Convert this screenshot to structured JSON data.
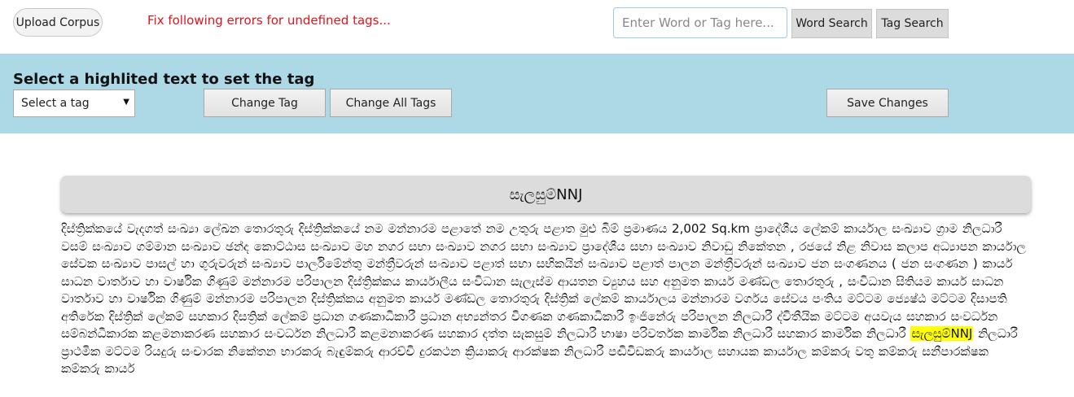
{
  "toolbar": {
    "upload_label": "Upload Corpus",
    "error_message": "Fix following errors for undefined tags...",
    "search_placeholder": "Enter Word or Tag here...",
    "word_search_label": "Word Search",
    "tag_search_label": "Tag Search"
  },
  "tag_bar": {
    "title": "Select a highlited text to set the tag",
    "select_value": "Select a tag",
    "change_tag_label": "Change Tag",
    "change_all_label": "Change All Tags",
    "save_label": "Save Changes",
    "background_color": "#add8e6"
  },
  "content": {
    "panel_heading": "සැලසුම්NNJ",
    "highlight_color": "#ffff00",
    "text_before": "දිස්ත්‍රික්කයේ වැදගත් සංඛ්‍යා ලේඛන තොරතුරු දිස්ත්‍රික්කයේ නම මන්නාරම පළාතේ නම උතුරු පළාත මුළු බිම් ප්‍රමාණය 2,002 Sq.km ප්‍රාදේශීය ලේකම් කාර්යාල සංඛ්‍යාව ග්‍රාම නිලධාරී වසම් සංඛ්‍යාව ගම්මාන සංඛ්‍යාව ඡන්ද කොට්ඨාස සංඛ්‍යාව මහ නගර සභා සංඛ්‍යාව නගර සභා සංඛ්‍යාව ප්‍රාදේශීය සභා සංඛ්‍යාව නිවාඩු නිකේතන , රජයේ නිළ නිවාස කලාප අධ්‍යාපන කාර්යාල සේවක සංඛ්‍යාව පාසල් හා ගුරුවරුන් සංඛ්‍යාව පාර්ලිමේන්තු මන්ත්‍රීවරුන් සංඛ්‍යාව පළාත් සභා සභිකයින් සංඛ්‍යාව පළාත් පාලන මන්ත්‍රීවරුන් සංඛ්‍යාව ජන සංගණනය ( ජන සංගණන ) කාර්ය සාධන වාර්තාව හා වාර්ෂික ගිණුම් මන්නාරම පරිපාලන දිස්ත්‍රික්කය කාර්යාලීය සංවිධාන සැලැස්ම ආයතන ව්‍යුහය සහ අනුමත කාර්ය මණ්ඩල තොරතුරු , සංවිධාන සිතියම කාර්ය සාධන වාර්තාව හා වාර්ෂික ගිණුම් මන්නාරම පරිපාලන දිස්ත්‍රික්කය අනුමත කාර්ය මණ්ඩල තොරතුරු දිස්ත්‍රික් ලේකම් කාර්යාලය මන්නාරම වර්ගය සේවය පංතිය මට්ටම ජ්‍යෙෂ්ඨ මට්ටම දිසාපති අතිරේක දිස්ත්‍රික් ලේකම් සහකාර දිසත්‍රික් ලේකම් ප්‍රධාන ගණකාධිකාරී ප්‍රධාන අභ්‍යන්තර විගණක ගණකාධිකාරී ඉංජිනේරු පරිපාලන නිලධාරී ද්විතීයික මට්ටම අයවැය සහකාර සංවර්ධන සම්බන්ධීකාරක කළමනාකරණ සහකාර සංවර්ධන නිලධාරී කළමනාකරණ සහකාර දත්ත සැකසුම් නිලධාරී භාෂා පරිවර්තක කාර්මික නිලධාරී සහකාර කාර්මික නිලධාරී",
    "highlighted_word": "සැලසුම්NNJ",
    "text_after": "නිලධාරී ප්‍රාථමික මට්ටම රියදුරු සංචාරක නිකේතන භාරකරු බැඳුම්කරු ආරච්චි දුරකථන ක්‍රියාකරු ආරක්ෂක නිලධාරී පඬිවිඩකරු කාර්යාල සහායක කාර්යාල කම්කරු වතු කම්කරු සනීපාරක්ෂක කම්කරු කාර්ය"
  }
}
